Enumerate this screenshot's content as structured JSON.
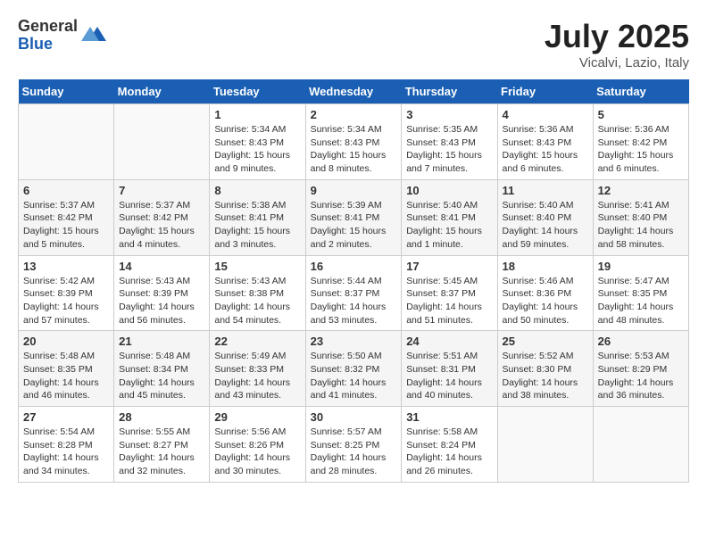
{
  "logo": {
    "general": "General",
    "blue": "Blue"
  },
  "title": "July 2025",
  "location": "Vicalvi, Lazio, Italy",
  "days_of_week": [
    "Sunday",
    "Monday",
    "Tuesday",
    "Wednesday",
    "Thursday",
    "Friday",
    "Saturday"
  ],
  "weeks": [
    [
      {
        "num": "",
        "info": ""
      },
      {
        "num": "",
        "info": ""
      },
      {
        "num": "1",
        "info": "Sunrise: 5:34 AM\nSunset: 8:43 PM\nDaylight: 15 hours\nand 9 minutes."
      },
      {
        "num": "2",
        "info": "Sunrise: 5:34 AM\nSunset: 8:43 PM\nDaylight: 15 hours\nand 8 minutes."
      },
      {
        "num": "3",
        "info": "Sunrise: 5:35 AM\nSunset: 8:43 PM\nDaylight: 15 hours\nand 7 minutes."
      },
      {
        "num": "4",
        "info": "Sunrise: 5:36 AM\nSunset: 8:43 PM\nDaylight: 15 hours\nand 6 minutes."
      },
      {
        "num": "5",
        "info": "Sunrise: 5:36 AM\nSunset: 8:42 PM\nDaylight: 15 hours\nand 6 minutes."
      }
    ],
    [
      {
        "num": "6",
        "info": "Sunrise: 5:37 AM\nSunset: 8:42 PM\nDaylight: 15 hours\nand 5 minutes."
      },
      {
        "num": "7",
        "info": "Sunrise: 5:37 AM\nSunset: 8:42 PM\nDaylight: 15 hours\nand 4 minutes."
      },
      {
        "num": "8",
        "info": "Sunrise: 5:38 AM\nSunset: 8:41 PM\nDaylight: 15 hours\nand 3 minutes."
      },
      {
        "num": "9",
        "info": "Sunrise: 5:39 AM\nSunset: 8:41 PM\nDaylight: 15 hours\nand 2 minutes."
      },
      {
        "num": "10",
        "info": "Sunrise: 5:40 AM\nSunset: 8:41 PM\nDaylight: 15 hours\nand 1 minute."
      },
      {
        "num": "11",
        "info": "Sunrise: 5:40 AM\nSunset: 8:40 PM\nDaylight: 14 hours\nand 59 minutes."
      },
      {
        "num": "12",
        "info": "Sunrise: 5:41 AM\nSunset: 8:40 PM\nDaylight: 14 hours\nand 58 minutes."
      }
    ],
    [
      {
        "num": "13",
        "info": "Sunrise: 5:42 AM\nSunset: 8:39 PM\nDaylight: 14 hours\nand 57 minutes."
      },
      {
        "num": "14",
        "info": "Sunrise: 5:43 AM\nSunset: 8:39 PM\nDaylight: 14 hours\nand 56 minutes."
      },
      {
        "num": "15",
        "info": "Sunrise: 5:43 AM\nSunset: 8:38 PM\nDaylight: 14 hours\nand 54 minutes."
      },
      {
        "num": "16",
        "info": "Sunrise: 5:44 AM\nSunset: 8:37 PM\nDaylight: 14 hours\nand 53 minutes."
      },
      {
        "num": "17",
        "info": "Sunrise: 5:45 AM\nSunset: 8:37 PM\nDaylight: 14 hours\nand 51 minutes."
      },
      {
        "num": "18",
        "info": "Sunrise: 5:46 AM\nSunset: 8:36 PM\nDaylight: 14 hours\nand 50 minutes."
      },
      {
        "num": "19",
        "info": "Sunrise: 5:47 AM\nSunset: 8:35 PM\nDaylight: 14 hours\nand 48 minutes."
      }
    ],
    [
      {
        "num": "20",
        "info": "Sunrise: 5:48 AM\nSunset: 8:35 PM\nDaylight: 14 hours\nand 46 minutes."
      },
      {
        "num": "21",
        "info": "Sunrise: 5:48 AM\nSunset: 8:34 PM\nDaylight: 14 hours\nand 45 minutes."
      },
      {
        "num": "22",
        "info": "Sunrise: 5:49 AM\nSunset: 8:33 PM\nDaylight: 14 hours\nand 43 minutes."
      },
      {
        "num": "23",
        "info": "Sunrise: 5:50 AM\nSunset: 8:32 PM\nDaylight: 14 hours\nand 41 minutes."
      },
      {
        "num": "24",
        "info": "Sunrise: 5:51 AM\nSunset: 8:31 PM\nDaylight: 14 hours\nand 40 minutes."
      },
      {
        "num": "25",
        "info": "Sunrise: 5:52 AM\nSunset: 8:30 PM\nDaylight: 14 hours\nand 38 minutes."
      },
      {
        "num": "26",
        "info": "Sunrise: 5:53 AM\nSunset: 8:29 PM\nDaylight: 14 hours\nand 36 minutes."
      }
    ],
    [
      {
        "num": "27",
        "info": "Sunrise: 5:54 AM\nSunset: 8:28 PM\nDaylight: 14 hours\nand 34 minutes."
      },
      {
        "num": "28",
        "info": "Sunrise: 5:55 AM\nSunset: 8:27 PM\nDaylight: 14 hours\nand 32 minutes."
      },
      {
        "num": "29",
        "info": "Sunrise: 5:56 AM\nSunset: 8:26 PM\nDaylight: 14 hours\nand 30 minutes."
      },
      {
        "num": "30",
        "info": "Sunrise: 5:57 AM\nSunset: 8:25 PM\nDaylight: 14 hours\nand 28 minutes."
      },
      {
        "num": "31",
        "info": "Sunrise: 5:58 AM\nSunset: 8:24 PM\nDaylight: 14 hours\nand 26 minutes."
      },
      {
        "num": "",
        "info": ""
      },
      {
        "num": "",
        "info": ""
      }
    ]
  ]
}
